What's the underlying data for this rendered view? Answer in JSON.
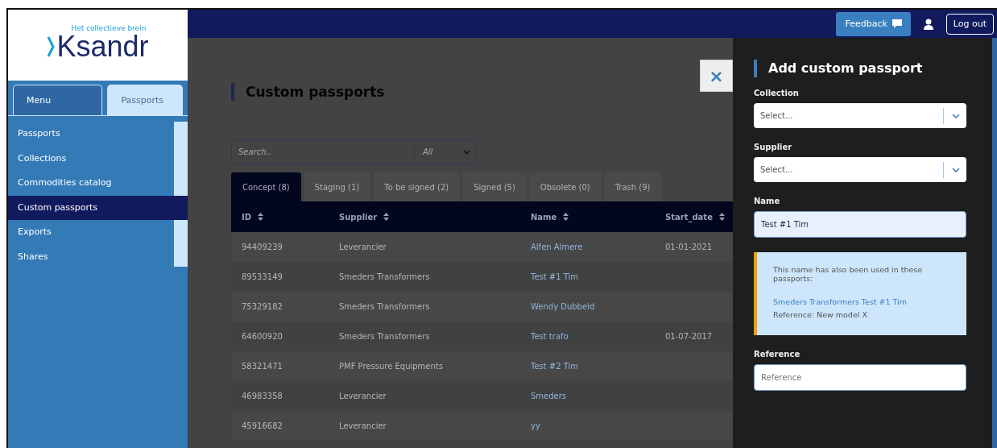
{
  "logo": {
    "name": "Ksandr",
    "tagline": "Het collectieve brein"
  },
  "sidebar": {
    "tabs": [
      {
        "label": "Menu",
        "selected": false
      },
      {
        "label": "Passports",
        "selected": true
      }
    ],
    "items": [
      {
        "label": "Passports",
        "selected": false
      },
      {
        "label": "Collections",
        "selected": false
      },
      {
        "label": "Commodities catalog",
        "selected": false
      },
      {
        "label": "Custom passports",
        "selected": true
      },
      {
        "label": "Exports",
        "selected": false
      },
      {
        "label": "Shares",
        "selected": false
      }
    ]
  },
  "top_bar": {
    "feedback": "Feedback",
    "logout": "Log out"
  },
  "page": {
    "title": "Custom passports",
    "search": {
      "placeholder": "Search.."
    },
    "filter": "All",
    "tabs": [
      {
        "label": "Concept (8)",
        "selected": true
      },
      {
        "label": "Staging (1)",
        "selected": false
      },
      {
        "label": "To be signed (2)",
        "selected": false
      },
      {
        "label": "Signed (5)",
        "selected": false
      },
      {
        "label": "Obsolete (0)",
        "selected": false
      },
      {
        "label": "Trash (9)",
        "selected": false
      }
    ],
    "table": {
      "columns": [
        "ID",
        "Supplier",
        "Name",
        "Start_date"
      ],
      "rows": [
        [
          "94409239",
          "Leverancier",
          "Alfen Almere",
          "01-01-2021"
        ],
        [
          "89533149",
          "Smeders Transformers",
          "Test #1 Tim",
          ""
        ],
        [
          "75329182",
          "Smeders Transformers",
          "Wendy Dubbeld",
          ""
        ],
        [
          "64600920",
          "Smeders Transformers",
          "Test trafo",
          "01-07-2017"
        ],
        [
          "58321471",
          "PMF Pressure Equipments",
          "Test #2 Tim",
          ""
        ],
        [
          "46983358",
          "Leverancier",
          "Smeders",
          ""
        ],
        [
          "45916682",
          "Leverancier",
          "yy",
          ""
        ]
      ]
    }
  },
  "panel": {
    "close": "×",
    "title": "Add custom passport",
    "fields": [
      {
        "kind": "select",
        "label": "Collection",
        "placeholder": "Select..."
      },
      {
        "kind": "select",
        "label": "Supplier",
        "placeholder": "Select..."
      },
      {
        "kind": "text",
        "label": "Name",
        "value": "Test #1 Tim"
      },
      {
        "kind": "notice",
        "text": "This name has also been used in these passports:",
        "link": "Smeders Transformers Test #1 Tim",
        "detail": "Reference: New model X"
      },
      {
        "kind": "text",
        "label": "Reference",
        "placeholder": "Reference"
      }
    ]
  }
}
